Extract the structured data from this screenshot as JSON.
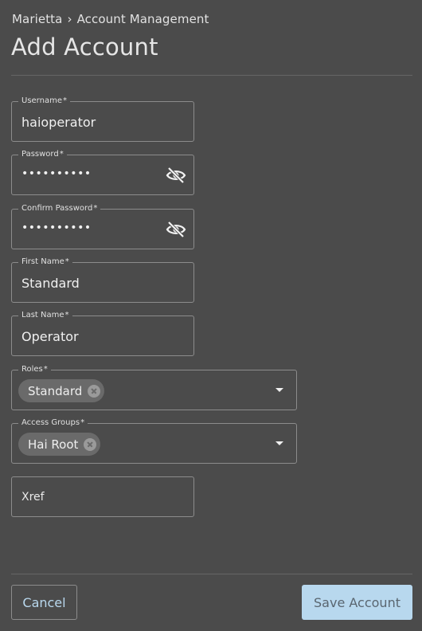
{
  "breadcrumb": {
    "parent": "Marietta",
    "separator": "›",
    "current": "Account Management"
  },
  "page_title": "Add Account",
  "form": {
    "username": {
      "label": "Username",
      "required_mark": "*",
      "value": "haioperator"
    },
    "password": {
      "label": "Password",
      "required_mark": "*",
      "value": "••••••••••",
      "icon": "eye-off-icon"
    },
    "confirm_password": {
      "label": "Confirm Password",
      "required_mark": "*",
      "value": "••••••••••",
      "icon": "eye-off-icon"
    },
    "first_name": {
      "label": "First Name",
      "required_mark": "*",
      "value": "Standard"
    },
    "last_name": {
      "label": "Last Name",
      "required_mark": "*",
      "value": "Operator"
    },
    "roles": {
      "label": "Roles",
      "required_mark": "*",
      "chips": [
        "Standard"
      ]
    },
    "access_groups": {
      "label": "Access Groups",
      "required_mark": "*",
      "chips": [
        "Hai Root"
      ]
    },
    "xref": {
      "placeholder": "Xref"
    }
  },
  "actions": {
    "cancel_label": "Cancel",
    "save_label": "Save Account"
  },
  "colors": {
    "background": "#4b4b4b",
    "border": "#8c8c8c",
    "chip": "#6a6a6a",
    "primary_button": "#b8d8ee",
    "link_text": "#b9d8ee"
  }
}
